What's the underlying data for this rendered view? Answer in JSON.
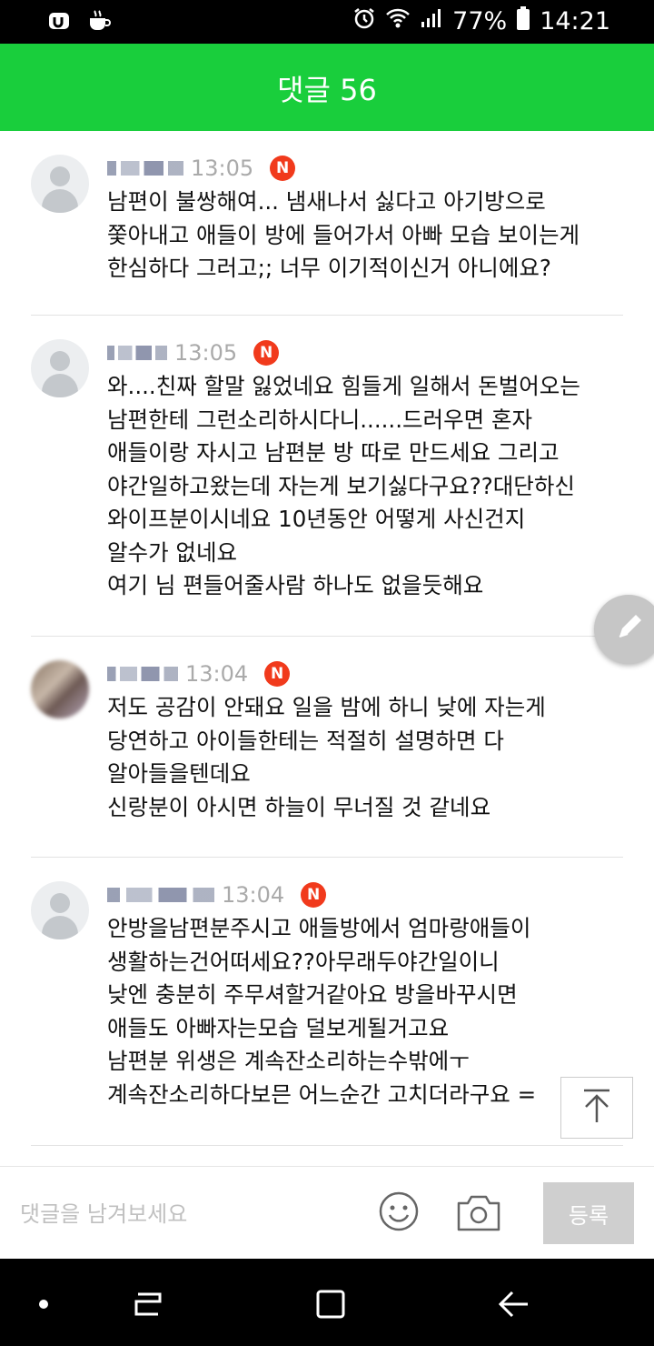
{
  "status_bar": {
    "battery": "77%",
    "time": "14:21"
  },
  "header": {
    "title": "댓글 56"
  },
  "comments": [
    {
      "time": "13:05",
      "badge": "N",
      "lines": [
        "남편이 불쌍해여... 냄새나서 싫다고 아기방으로",
        "쫓아내고 애들이 방에 들어가서 아빠 모습 보이는게",
        "한심하다 그러고;; 너무 이기적이신거 아니에요?"
      ]
    },
    {
      "time": "13:05",
      "badge": "N",
      "lines": [
        "와....친짜 할말 잃었네요 힘들게 일해서 돈벌어오는",
        "남편한테 그런소리하시다니......드러우면 혼자",
        "애들이랑 자시고 남편분 방 따로 만드세요 그리고",
        "야간일하고왔는데 자는게 보기싫다구요??대단하신",
        "와이프분이시네요 10년동안 어떻게 사신건지",
        "알수가 없네요",
        "여기 님 편들어줄사람 하나도 없을듯해요"
      ]
    },
    {
      "time": "13:04",
      "badge": "N",
      "lines": [
        "저도 공감이 안돼요 일을 밤에 하니 낮에 자는게",
        "당연하고 아이들한테는 적절히 설명하면 다",
        "알아들을텐데요",
        "신랑분이 아시면 하늘이 무너질 것 같네요"
      ]
    },
    {
      "time": "13:04",
      "badge": "N",
      "lines": [
        "안방을남편분주시고 애들방에서 엄마랑애들이",
        "생활하는건어떠세요??아무래두야간일이니",
        "낮엔 충분히 주무셔할거같아요 방을바꾸시면",
        "애들도 아빠자는모습 덜보게될거고요",
        "남편분 위생은 계속잔소리하는수밖에ㅜ",
        "계속잔소리하다보믄 어느순간 고치더라구요 ="
      ]
    }
  ],
  "composer": {
    "placeholder": "댓글을 남겨보세요",
    "submit_label": "등록"
  },
  "icons": {
    "write": "pencil-icon",
    "scroll_top": "arrow-up-icon",
    "emoji": "smiley-icon",
    "camera": "camera-icon"
  },
  "colors": {
    "header": "#19ce3c",
    "badge": "#f13a1c"
  }
}
